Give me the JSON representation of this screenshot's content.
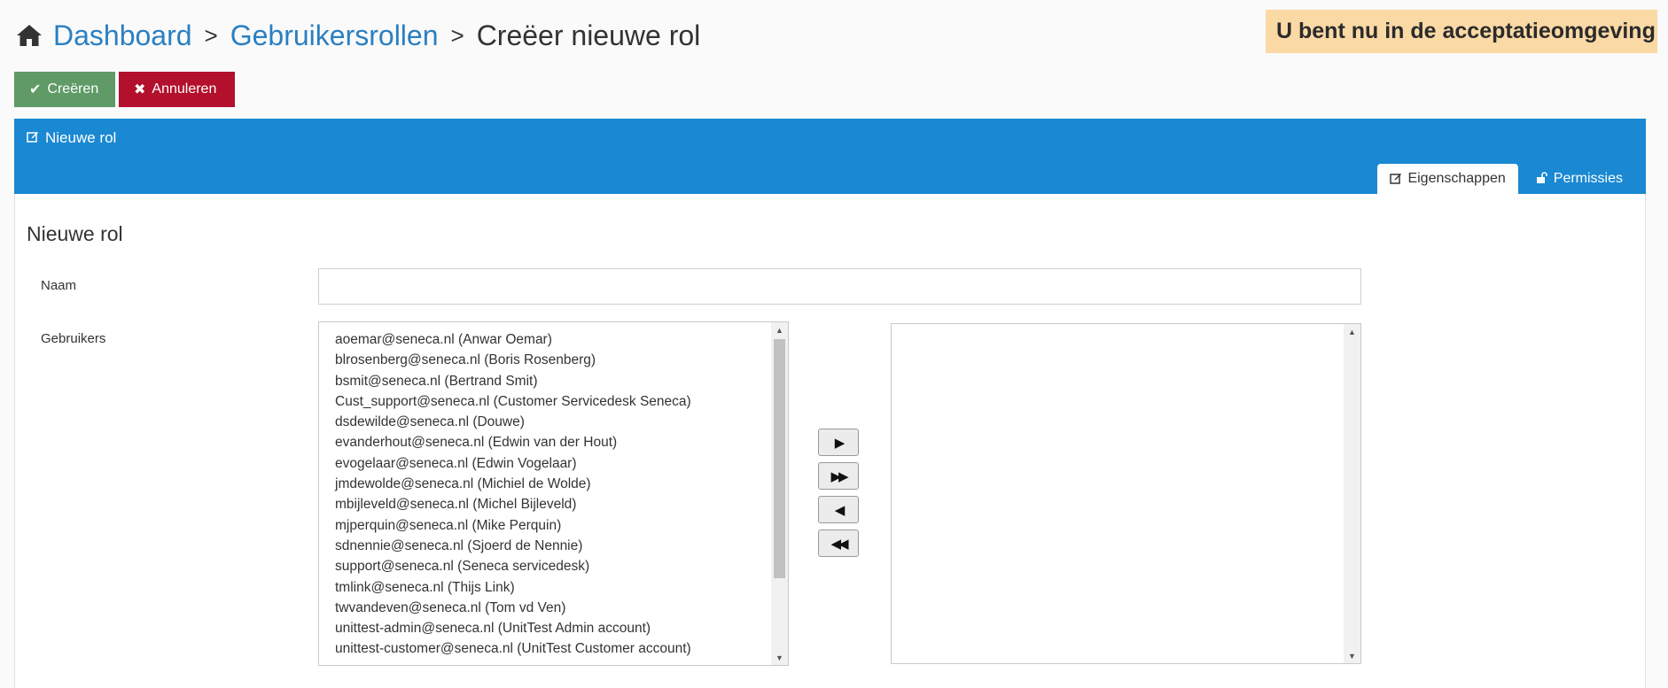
{
  "breadcrumb": {
    "home_icon": "home-icon",
    "items": [
      "Dashboard",
      "Gebruikersrollen"
    ],
    "separator": ">",
    "current": "Creëer nieuwe rol"
  },
  "environment_banner": "U bent nu in de acceptatieomgeving",
  "actions": {
    "create_label": "Creëren",
    "create_icon": "check-icon",
    "cancel_label": "Annuleren",
    "cancel_icon": "x-icon"
  },
  "panel": {
    "title": "Nieuwe rol",
    "title_icon": "edit-icon",
    "tabs": [
      {
        "label": "Eigenschappen",
        "icon": "edit-icon",
        "active": true
      },
      {
        "label": "Permissies",
        "icon": "unlock-icon",
        "active": false
      }
    ]
  },
  "form": {
    "section_title": "Nieuwe rol",
    "name_label": "Naam",
    "name_value": "",
    "users_label": "Gebruikers",
    "available_users": [
      "aoemar@seneca.nl (Anwar Oemar)",
      "blrosenberg@seneca.nl (Boris Rosenberg)",
      "bsmit@seneca.nl (Bertrand Smit)",
      "Cust_support@seneca.nl (Customer Servicedesk Seneca)",
      "dsdewilde@seneca.nl (Douwe)",
      "evanderhout@seneca.nl (Edwin van der Hout)",
      "evogelaar@seneca.nl (Edwin Vogelaar)",
      "jmdewolde@seneca.nl (Michiel de Wolde)",
      "mbijleveld@seneca.nl (Michel Bijleveld)",
      "mjperquin@seneca.nl (Mike Perquin)",
      "sdnennie@seneca.nl (Sjoerd de Nennie)",
      "support@seneca.nl (Seneca servicedesk)",
      "tmlink@seneca.nl (Thijs Link)",
      "twvandeven@seneca.nl (Tom vd Ven)",
      "unittest-admin@seneca.nl (UnitTest Admin account)",
      "unittest-customer@seneca.nl (UnitTest Customer account)"
    ],
    "selected_users": [],
    "move_buttons": [
      "▶",
      "▶▶",
      "◀",
      "◀◀"
    ]
  },
  "colors": {
    "link": "#2a7fc1",
    "panel_header": "#1a88d2",
    "create_button": "#5f9a67",
    "cancel_button": "#b3102d",
    "banner": "#fbd9a5"
  }
}
